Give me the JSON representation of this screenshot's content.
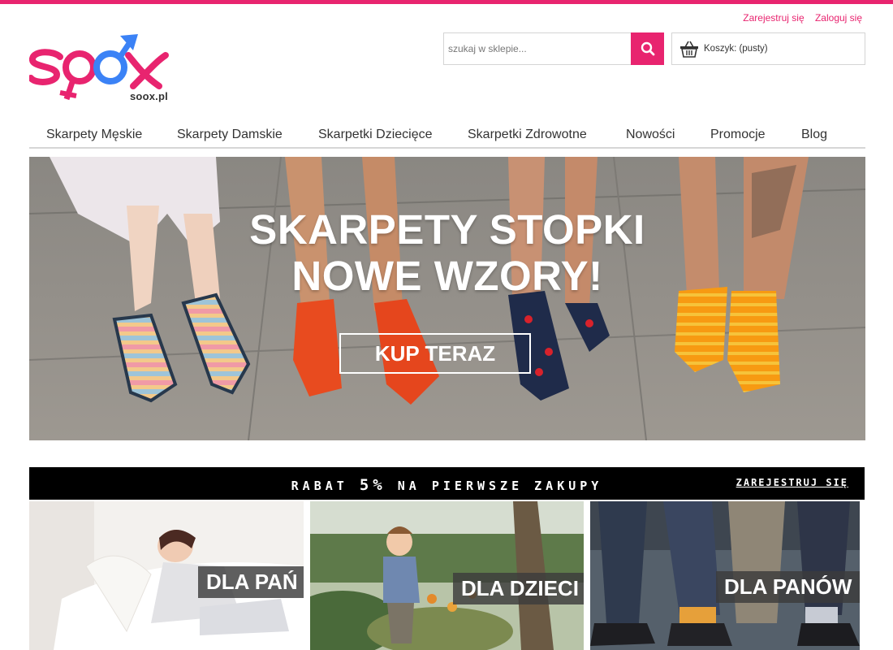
{
  "brand": {
    "name": "soox.pl",
    "primary_color": "#e8246f",
    "secondary_color": "#3b82f6"
  },
  "header": {
    "register_label": "Zarejestruj się",
    "login_label": "Zaloguj się",
    "search": {
      "placeholder": "szukaj w sklepie...",
      "button_icon": "search-icon"
    },
    "cart": {
      "label": "Koszyk: (pusty)",
      "icon": "basket-icon"
    }
  },
  "nav": {
    "items": [
      {
        "label": "Skarpety Męskie"
      },
      {
        "label": "Skarpety Damskie"
      },
      {
        "label": "Skarpetki Dziecięce"
      },
      {
        "label": "Skarpetki Zdrowotne"
      },
      {
        "label": "Nowości"
      },
      {
        "label": "Promocje"
      },
      {
        "label": "Blog"
      }
    ]
  },
  "hero": {
    "line1": "SKARPETY STOPKI",
    "line2": "NOWE WZORY!",
    "cta": "KUP TERAZ"
  },
  "promo": {
    "text_before": "RABAT ",
    "highlight": "5%",
    "text_after": " NA PIERWSZE ZAKUPY",
    "link_label": "ZAREJESTRUJ SIĘ"
  },
  "categories": [
    {
      "label": "DLA PAŃ"
    },
    {
      "label": "DLA DZIECI"
    },
    {
      "label": "DLA PANÓW"
    }
  ]
}
